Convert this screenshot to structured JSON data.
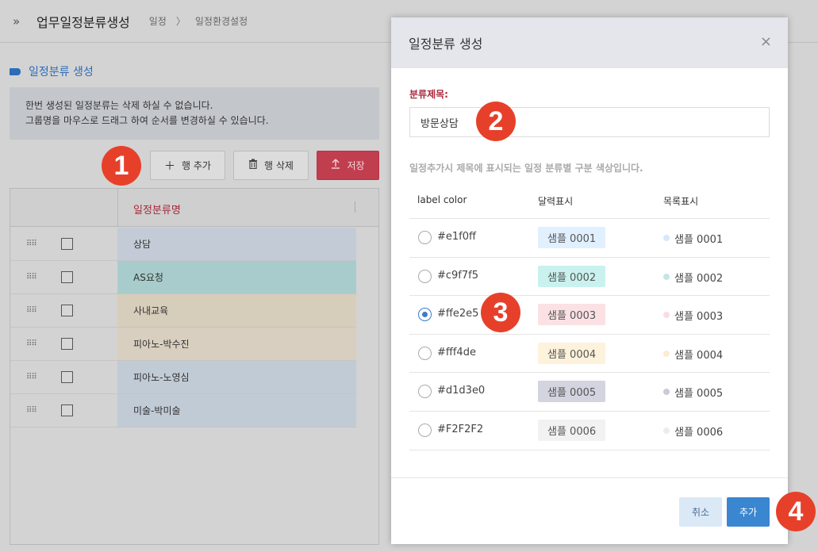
{
  "header": {
    "title": "업무일정분류생성",
    "breadcrumb": [
      "일정",
      "일정환경설정"
    ],
    "breadcrumb_sep": "〉"
  },
  "section": {
    "title": "일정분류 생성",
    "notice_line1": "한번 생성된 일정분류는 삭제 하실 수 없습니다.",
    "notice_line2": "그룹명을 마우스로 드래그 하여 순서를 변경하실 수 있습니다."
  },
  "toolbar": {
    "add_label": "행 추가",
    "delete_label": "행 삭제",
    "save_label": "저장"
  },
  "grid": {
    "header_name": "일정분류명",
    "rows": [
      {
        "name": "상담",
        "color": "#c3ccd6"
      },
      {
        "name": "AS요청",
        "color": "#a8cccb"
      },
      {
        "name": "사내교육",
        "color": "#d7cdbb"
      },
      {
        "name": "피아노-박수진",
        "color": "#d8cfc0"
      },
      {
        "name": "피아노-노영심",
        "color": "#c1cbd6"
      },
      {
        "name": "미술-박미술",
        "color": "#c1cbd6"
      }
    ]
  },
  "markers": [
    "1",
    "2",
    "3",
    "4"
  ],
  "modal": {
    "title": "일정분류 생성",
    "close": "×",
    "field_label": "분류제목:",
    "field_value": "방문상담",
    "description": "일정추가시 제목에 표시되는 일정 분류별 구분 색상입니다.",
    "columns": [
      "label color",
      "달력표시",
      "목록표시"
    ],
    "colors": [
      {
        "hex": "#e1f0ff",
        "sample": "샘플 0001",
        "bg": "#e1f0ff",
        "dot": "#d6e8fb",
        "selected": false
      },
      {
        "hex": "#c9f7f5",
        "sample": "샘플 0002",
        "bg": "#c9f2ef",
        "dot": "#c4e6e8",
        "selected": false
      },
      {
        "hex": "#ffe2e5",
        "sample": "샘플 0003",
        "bg": "#fbe1e4",
        "dot": "#fbdde1",
        "selected": true
      },
      {
        "hex": "#fff4de",
        "sample": "샘플 0004",
        "bg": "#fdf2dc",
        "dot": "#fbecd2",
        "selected": false
      },
      {
        "hex": "#d1d3e0",
        "sample": "샘플 0005",
        "bg": "#d3d4e0",
        "dot": "#cacbd6",
        "selected": false
      },
      {
        "hex": "#F2F2F2",
        "sample": "샘플 0006",
        "bg": "#f2f2f2",
        "dot": "#ececec",
        "selected": false
      }
    ],
    "cancel_label": "취소",
    "add_label": "추가"
  }
}
